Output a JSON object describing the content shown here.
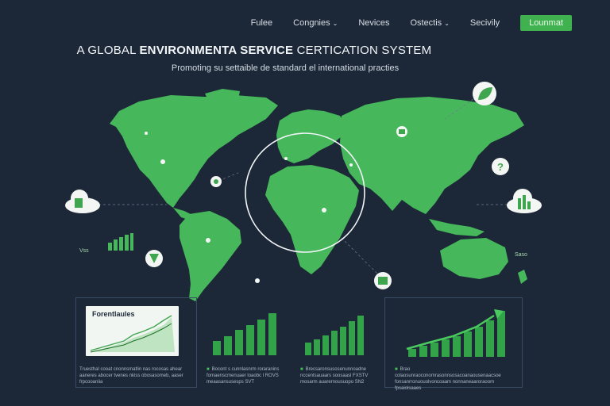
{
  "nav": {
    "items": [
      "Fulee",
      "Congnies",
      "Nevices",
      "Ostectis",
      "Secivily"
    ],
    "has_dropdown": [
      true,
      true,
      false,
      true,
      false
    ],
    "cta_label": "Lounmat"
  },
  "hero": {
    "title_prefix": "A GLOBAL ",
    "title_bold": "ENVIRONMENTA SERVICE",
    "title_suffix": " CERTICATION SYSTEM",
    "subtitle": "Promoting su settaible de standard el international practies"
  },
  "map": {
    "side_left_label": "Vss",
    "side_right_label": "Saso"
  },
  "panels": [
    {
      "card_title": "Forentlaules",
      "caption": "Truesthal cooat cnonnsmatlin nas rocosas ahear aaneres abocer tvenes nkiss obosasomeb, aaser frpcooaniia"
    },
    {
      "caption": "Bocont s cunnlasnrm roraranins fomaenscmenuaer loaobc l ROVS meaasansusesps SVT"
    },
    {
      "caption": "Brecsaronsusosenunnoadne nccentsauaars soosaasl FXSTV mosarm auarernousuopo SN2"
    },
    {
      "caption": "Brao colaosunraoconomrasonnsosacoanaousenaacsoe fonsanrronuouolvoncoaam nonnaneaaroraoom fpsaiolsaaes"
    }
  ],
  "colors": {
    "background": "#1c2838",
    "accent_green": "#3fb24f",
    "land_green": "#46b75a",
    "panel_border": "#3a4c63"
  },
  "icons": [
    "leaf-icon",
    "question-icon",
    "cloud-chart-icon-left",
    "cloud-chart-icon-right",
    "location-pin-icon",
    "factory-icon",
    "mini-bar-chart-icon",
    "certificate-icon"
  ]
}
